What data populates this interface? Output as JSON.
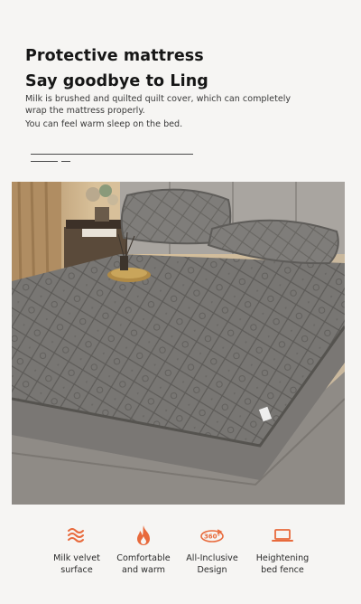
{
  "header": {
    "title_line1": "Protective mattress",
    "title_line2": "Say goodbye to Ling",
    "description_line1": "Milk is brushed and quilted quilt cover, which can completely",
    "description_line2": "wrap the mattress properly.",
    "description_line3": "You can feel warm sleep on the bed."
  },
  "colors": {
    "accent": "#e86a3c",
    "background": "#f6f5f3",
    "mattress": "#6f6d6a"
  },
  "features": [
    {
      "icon": "waves-icon",
      "label": "Milk velvet\nsurface"
    },
    {
      "icon": "flame-icon",
      "label": "Comfortable\nand warm"
    },
    {
      "icon": "360-rotate-icon",
      "label": "All-Inclusive\nDesign"
    },
    {
      "icon": "laptop-fence-icon",
      "label": "Heightening\nbed fence"
    }
  ]
}
